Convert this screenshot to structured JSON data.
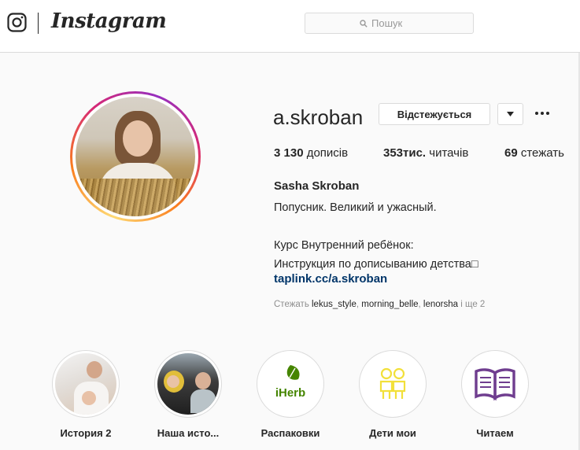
{
  "header": {
    "logo_text": "Instagram",
    "search_placeholder": "Пошук"
  },
  "profile": {
    "username": "a.skroban",
    "unfollow_label": "Відстежується",
    "stats": {
      "posts_count": "3 130",
      "posts_label": " дописів",
      "followers_count": "353тис.",
      "followers_label": " читачів",
      "following_count": "69",
      "following_label": " стежать"
    },
    "full_name": "Sasha Skroban",
    "bio": "Попусник. Великий и ужасный.\n\nКурс Внутренний ребёнок:\nИнструкция по дописыванию детства□",
    "link": "taplink.cc/a.skroban",
    "followed_by": {
      "prefix": "Стежать ",
      "accounts": [
        "lekus_style",
        "morning_belle",
        "lenorsha"
      ],
      "suffix": " і ще 2"
    }
  },
  "highlights": [
    {
      "label": "История 2",
      "icon": "photo"
    },
    {
      "label": "Наша исто...",
      "icon": "photo"
    },
    {
      "label": "Распаковки",
      "icon": "iherb-logo",
      "logo_text": "iHerb",
      "color": "#458500"
    },
    {
      "label": "Дети мои",
      "icon": "kids-icon",
      "color": "#f2e03a"
    },
    {
      "label": "Читаем",
      "icon": "book-icon",
      "color": "#6f3d8f"
    }
  ]
}
